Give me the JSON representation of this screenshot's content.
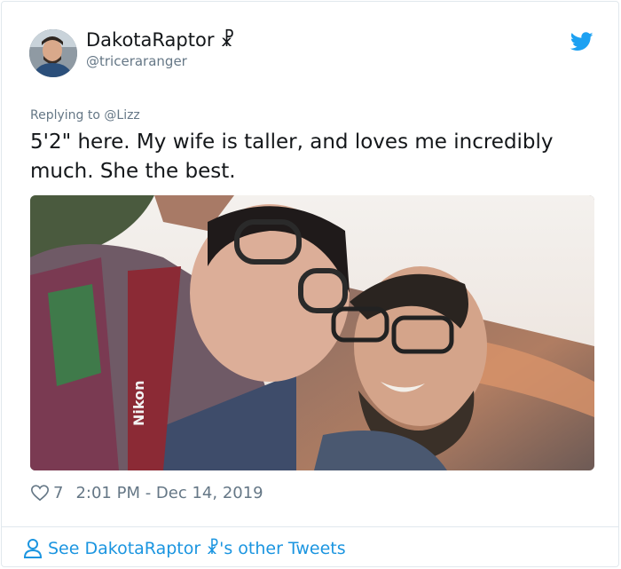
{
  "author": {
    "display_name": "DakotaRaptor ☧",
    "handle": "@triceraranger",
    "avatar_icon": "user-avatar"
  },
  "brand": {
    "icon": "twitter-bird-icon",
    "color": "#1da1f2"
  },
  "tweet": {
    "replying_prefix": "Replying to ",
    "replying_to": "@Lizz",
    "text": "5'2\" here. My wife is taller, and loves me incredibly much. She the best.",
    "image_icon": "selfie-photo"
  },
  "meta": {
    "likes": "7",
    "timestamp": "2:01 PM - Dec 14, 2019",
    "like_icon": "heart-icon"
  },
  "footer": {
    "link_text": "See DakotaRaptor ☧'s other Tweets",
    "icon": "person-icon",
    "color": "#1b95e0"
  }
}
